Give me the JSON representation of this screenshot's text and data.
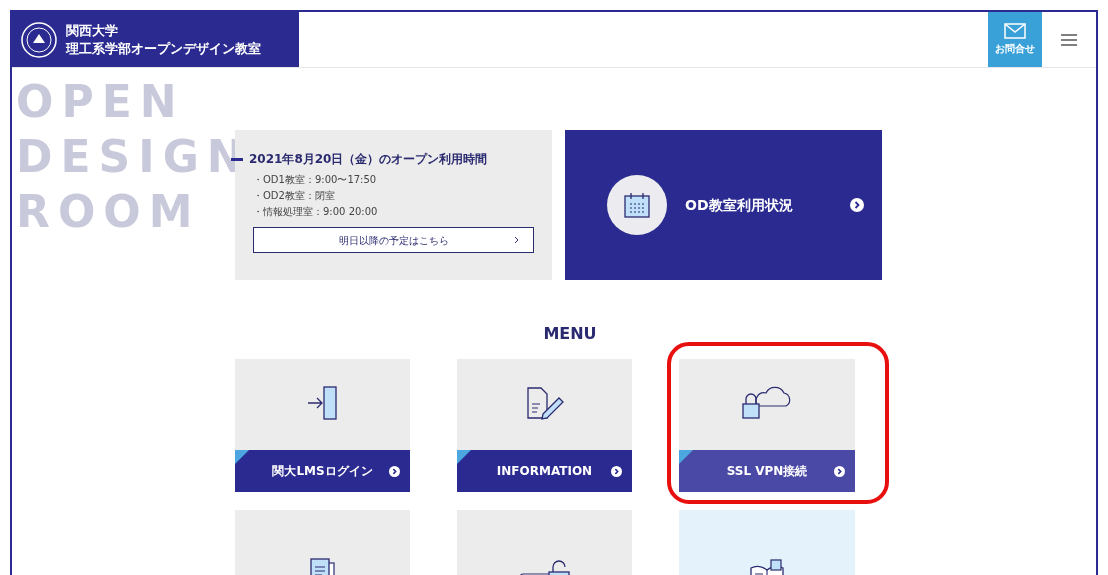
{
  "header": {
    "university": "関西大学",
    "site_title": "理工系学部オープンデザイン教室",
    "contact_label": "お問合せ"
  },
  "backdrop_words": [
    "OPEN",
    "DESIGN",
    "ROOM"
  ],
  "schedule": {
    "title": "2021年8月20日（金）のオープン利用時間",
    "lines": [
      "・OD1教室：9:00〜17:50",
      "・OD2教室：閉室",
      "・情報処理室：9:00 20:00"
    ],
    "link": "明日以降の予定はこちら"
  },
  "status_card": {
    "label": "OD教室利用状況"
  },
  "menu": {
    "title": "MENU",
    "tiles": [
      {
        "kind": "login",
        "label": "関大LMSログイン",
        "highlighted": false,
        "hovered": false
      },
      {
        "kind": "info",
        "label": "INFORMATION",
        "highlighted": false,
        "hovered": false
      },
      {
        "kind": "vpn",
        "label": "SSL VPN接続",
        "highlighted": true,
        "hovered": false
      },
      {
        "kind": "document",
        "hovered": false
      },
      {
        "kind": "password",
        "hovered": false
      },
      {
        "kind": "manual",
        "hovered": true
      }
    ]
  }
}
